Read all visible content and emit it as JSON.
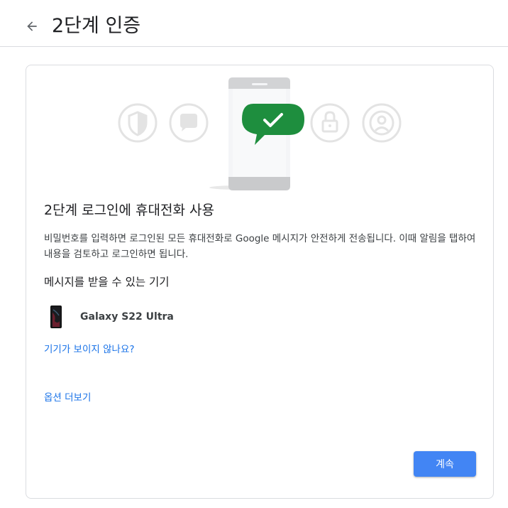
{
  "header": {
    "back_icon": "arrow-back-icon",
    "title": "2단계 인증"
  },
  "card": {
    "illustration_icons": [
      "shield-icon",
      "chat-bubble-icon",
      "phone-icon",
      "checkmark-icon",
      "lock-icon",
      "account-icon"
    ],
    "title": "2단계 로그인에 휴대전화 사용",
    "description": "비밀번호를 입력하면 로그인된 모든 휴대전화로 Google 메시지가 안전하게 전송됩니다. 이때 알림을 탭하여 내용을 검토하고 로그인하면 됩니다.",
    "devices_heading": "메시지를 받을 수 있는 기기",
    "devices": [
      {
        "name": "Galaxy S22 Ultra",
        "icon": "phone-icon"
      }
    ],
    "no_device_link": "기기가 보이지 않나요?",
    "more_options_link": "옵션 더보기",
    "continue_button": "계속"
  },
  "colors": {
    "accent": "#4285f4",
    "link": "#1a73e8",
    "check_green": "#1e8e3e",
    "icon_gray": "#e0e0e0",
    "border": "#dadce0"
  }
}
